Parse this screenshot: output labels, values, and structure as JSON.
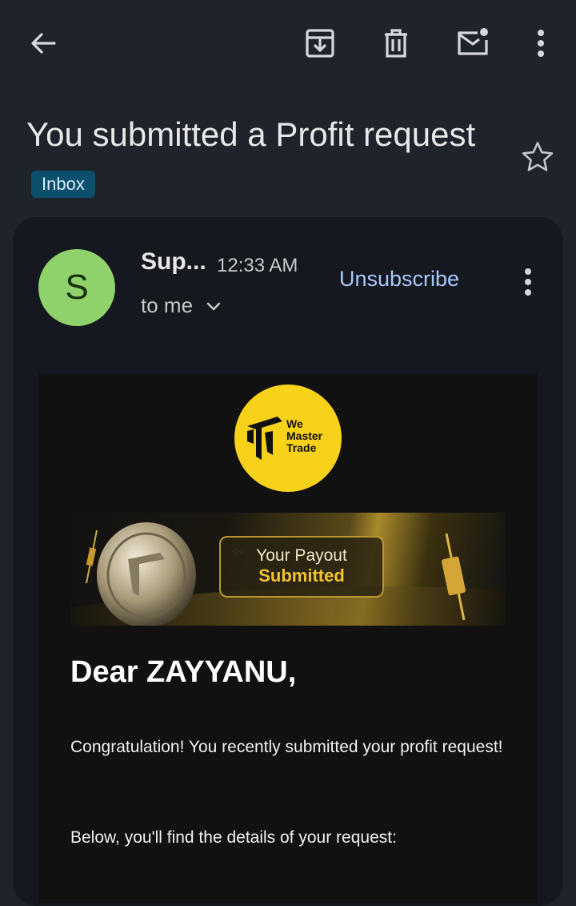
{
  "toolbar": {
    "back_icon": "arrow-left-icon",
    "archive_icon": "archive-icon",
    "delete_icon": "trash-icon",
    "unread_icon": "mark-unread-icon",
    "more_icon": "more-vert-icon"
  },
  "email": {
    "subject": "You submitted a Profit request",
    "label": "Inbox",
    "sender": {
      "initial": "S",
      "name": "Sup...",
      "time": "12:33 AM",
      "recipient": "to me",
      "avatar_color": "#8fd16a"
    },
    "unsubscribe_label": "Unsubscribe"
  },
  "body": {
    "logo": {
      "line1": "We",
      "line2": "Master",
      "line3": "Trade",
      "bg_color": "#f8d21a"
    },
    "banner": {
      "line1": "Your Payout",
      "line2": "Submitted",
      "accent_color": "#f2c331"
    },
    "greeting": "Dear ZAYYANU,",
    "paragraph1": "Congratulation! You recently submitted your profit request!",
    "paragraph2": "Below, you'll find the details of your request:"
  },
  "colors": {
    "background": "#1f232b",
    "card": "#15181e",
    "link": "#a8c7fa",
    "badge": "#0b4f6c"
  }
}
